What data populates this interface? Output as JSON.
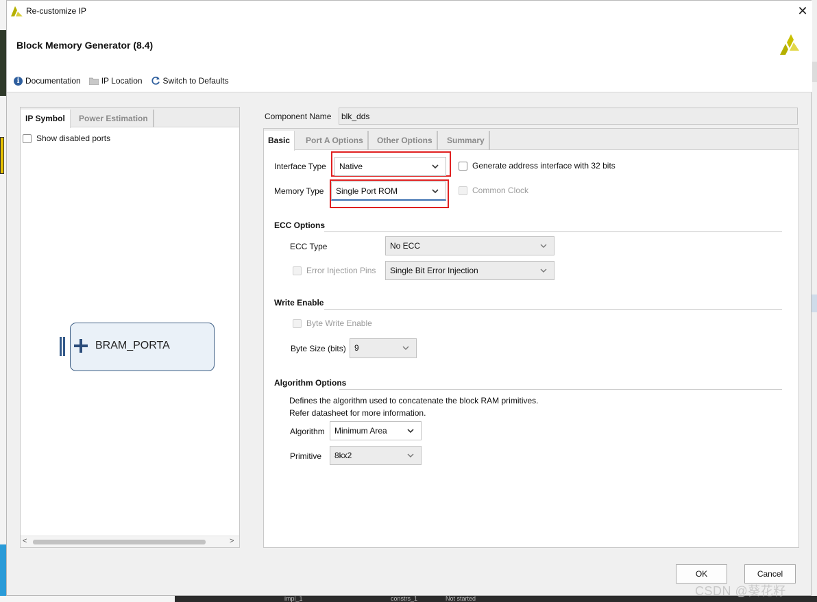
{
  "window": {
    "title": "Re-customize IP",
    "close_label": "✕"
  },
  "header": {
    "title": "Block Memory Generator (8.4)",
    "toolbar": {
      "documentation": "Documentation",
      "ip_location": "IP Location",
      "switch_defaults": "Switch to Defaults"
    }
  },
  "left_panel": {
    "tabs": [
      "IP Symbol",
      "Power Estimation"
    ],
    "show_disabled_ports": "Show disabled ports",
    "symbol_label": "BRAM_PORTA",
    "scroll_left": "<",
    "scroll_right": ">"
  },
  "component": {
    "label": "Component Name",
    "value": "blk_dds"
  },
  "right_panel": {
    "tabs": [
      "Basic",
      "Port A Options",
      "Other Options",
      "Summary"
    ],
    "interface_type": {
      "label": "Interface Type",
      "value": "Native"
    },
    "generate_addr": "Generate address interface with 32 bits",
    "memory_type": {
      "label": "Memory Type",
      "value": "Single Port ROM"
    },
    "common_clock": "Common Clock",
    "ecc": {
      "title": "ECC Options",
      "type_label": "ECC Type",
      "type_value": "No ECC",
      "error_pins_label": "Error Injection Pins",
      "error_pins_value": "Single Bit Error Injection"
    },
    "write_enable": {
      "title": "Write Enable",
      "byte_write": "Byte Write Enable",
      "byte_size_label": "Byte Size (bits)",
      "byte_size_value": "9"
    },
    "algorithm": {
      "title": "Algorithm Options",
      "desc1": "Defines the algorithm used to concatenate the block RAM primitives.",
      "desc2": "Refer datasheet for more information.",
      "algorithm_label": "Algorithm",
      "algorithm_value": "Minimum Area",
      "primitive_label": "Primitive",
      "primitive_value": "8kx2"
    }
  },
  "buttons": {
    "ok": "OK",
    "cancel": "Cancel"
  },
  "watermark": "CSDN @葵花籽",
  "background_taskbar": [
    "impl_1",
    "constrs_1",
    "Not started"
  ],
  "colors": {
    "highlight": "#e02020",
    "accent": "#2f5f9e",
    "logo": "#b5b000"
  }
}
